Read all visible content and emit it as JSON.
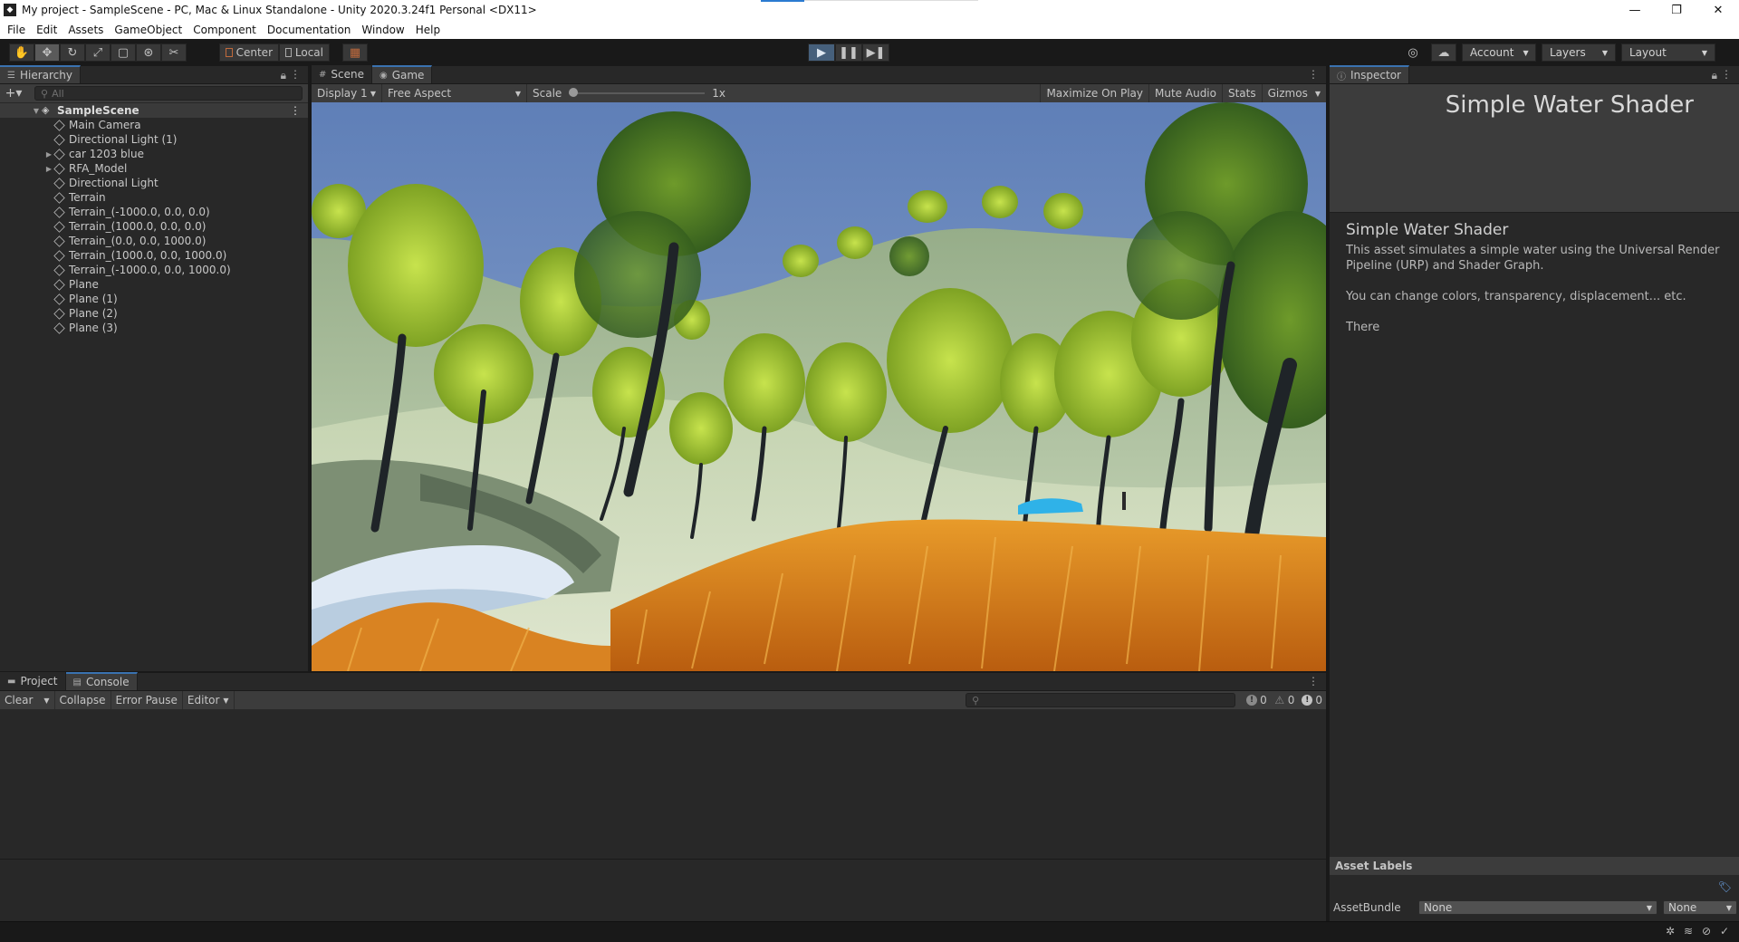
{
  "window": {
    "title": "My project - SampleScene - PC, Mac & Linux Standalone - Unity 2020.3.24f1 Personal <DX11>",
    "minimize": "—",
    "restore": "❐",
    "close": "✕"
  },
  "menu": [
    "File",
    "Edit",
    "Assets",
    "GameObject",
    "Component",
    "Documentation",
    "Window",
    "Help"
  ],
  "toolbar": {
    "pivot_center": "Center",
    "pivot_local": "Local",
    "account": "Account",
    "layers": "Layers",
    "layout": "Layout"
  },
  "hierarchy": {
    "tab": "Hierarchy",
    "search_placeholder": "All",
    "scene": "SampleScene",
    "items": [
      {
        "label": "Main Camera",
        "expandable": false
      },
      {
        "label": "Directional Light (1)",
        "expandable": false
      },
      {
        "label": "car 1203 blue",
        "expandable": true
      },
      {
        "label": "RFA_Model",
        "expandable": true
      },
      {
        "label": "Directional Light",
        "expandable": false
      },
      {
        "label": "Terrain",
        "expandable": false
      },
      {
        "label": "Terrain_(-1000.0, 0.0, 0.0)",
        "expandable": false
      },
      {
        "label": "Terrain_(1000.0, 0.0, 0.0)",
        "expandable": false
      },
      {
        "label": "Terrain_(0.0, 0.0, 1000.0)",
        "expandable": false
      },
      {
        "label": "Terrain_(1000.0, 0.0, 1000.0)",
        "expandable": false
      },
      {
        "label": "Terrain_(-1000.0, 0.0, 1000.0)",
        "expandable": false
      },
      {
        "label": "Plane",
        "expandable": false
      },
      {
        "label": "Plane (1)",
        "expandable": false
      },
      {
        "label": "Plane (2)",
        "expandable": false
      },
      {
        "label": "Plane (3)",
        "expandable": false
      }
    ]
  },
  "game": {
    "tab_scene": "Scene",
    "tab_game": "Game",
    "display": "Display 1",
    "aspect": "Free Aspect",
    "scale_label": "Scale",
    "scale_value": "1x",
    "maximize": "Maximize On Play",
    "mute": "Mute Audio",
    "stats": "Stats",
    "gizmos": "Gizmos"
  },
  "inspector": {
    "tab": "Inspector",
    "header_title": "Simple Water Shader",
    "body_title": "Simple Water Shader",
    "paragraphs": [
      "This asset simulates a simple water using the Universal Render Pipeline (URP) and Shader Graph.",
      "You can change colors, transparency, displacement... etc.",
      "There"
    ],
    "asset_labels": "Asset Labels",
    "asset_bundle_label": "AssetBundle",
    "asset_bundle_value": "None",
    "asset_variant_value": "None"
  },
  "console": {
    "tab_project": "Project",
    "tab_console": "Console",
    "clear": "Clear",
    "collapse": "Collapse",
    "error_pause": "Error Pause",
    "editor": "Editor",
    "log_count": "0",
    "warn_count": "0",
    "error_count": "0"
  },
  "colors": {
    "accent": "#3a72b0",
    "panel_bg": "#282828",
    "toolbar_bg": "#3c3c3c",
    "play_active": "#46607c"
  }
}
